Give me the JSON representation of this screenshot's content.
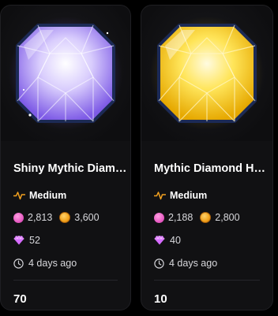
{
  "cards": [
    {
      "title": "Shiny Mythic Diamond Helmet",
      "title_display": "Shiny Mythic Diamo...",
      "difficulty": "Medium",
      "cost_pink": "2,813",
      "cost_gold": "3,600",
      "gems": "52",
      "time": "4 days ago",
      "count": "70",
      "art_icon": "purple-diamond-egg-icon",
      "accent": "#9b7bff"
    },
    {
      "title": "Mythic Diamond Helmet",
      "title_display": "Mythic Diamond He...",
      "difficulty": "Medium",
      "cost_pink": "2,188",
      "cost_gold": "2,800",
      "gems": "40",
      "time": "4 days ago",
      "count": "10",
      "art_icon": "gold-diamond-egg-icon",
      "accent": "#f5c518"
    }
  ],
  "colors": {
    "difficulty_icon": "#f0a020",
    "pink_currency": "#e85cc4",
    "gold_currency": "#f2a21b",
    "gem": "#d66cff",
    "card_bg": "#111113"
  }
}
